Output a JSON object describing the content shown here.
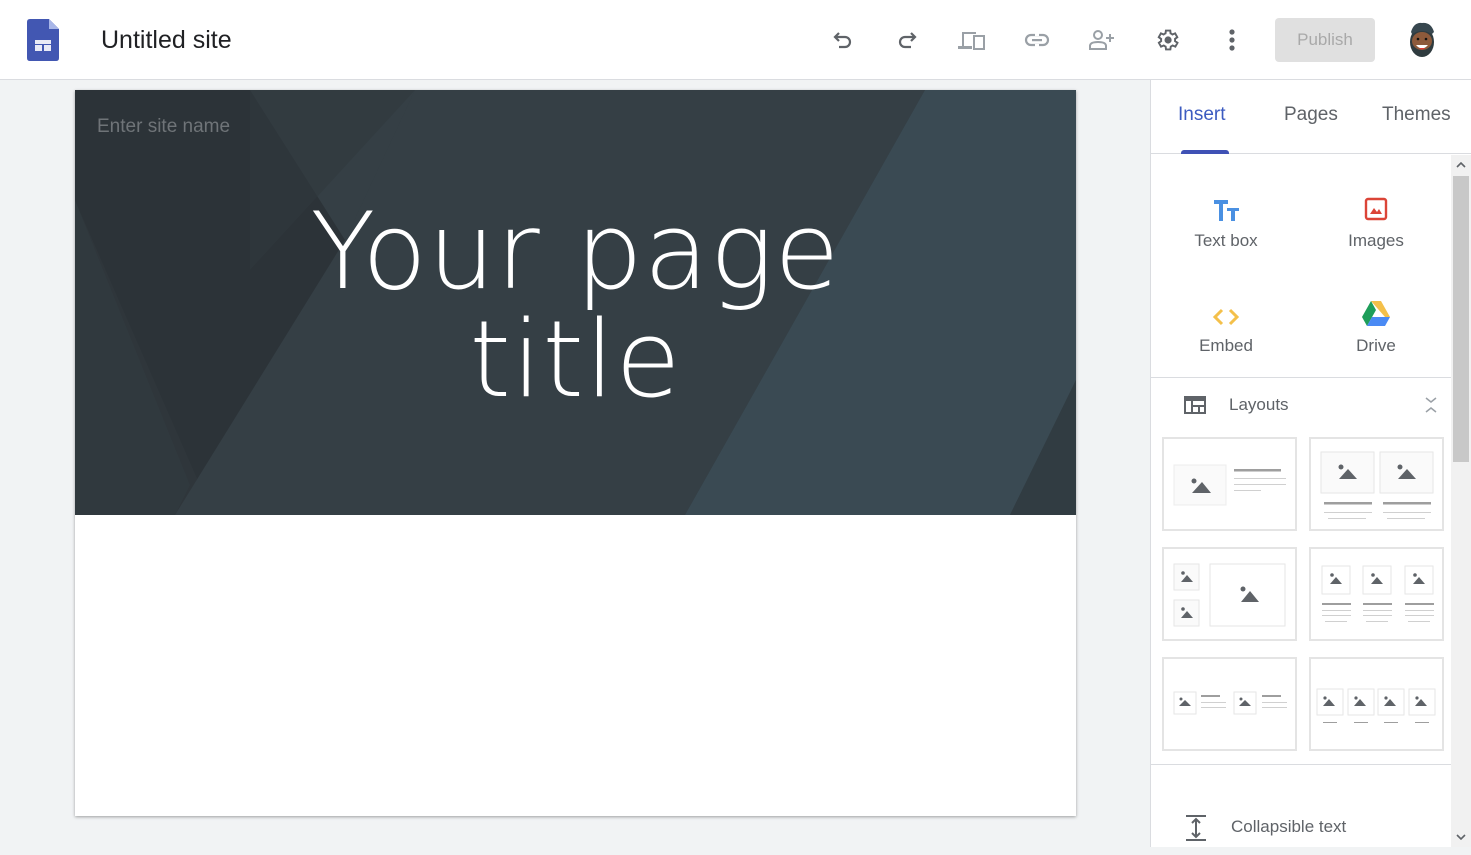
{
  "app": {
    "title": "Untitled site",
    "logo": "google-sites-logo"
  },
  "toolbar": {
    "icons": [
      "undo-icon",
      "redo-icon",
      "preview-devices-icon",
      "link-icon",
      "add-person-icon",
      "settings-gear-icon",
      "more-vert-icon"
    ],
    "publish_label": "Publish",
    "avatar": "user-avatar"
  },
  "canvas": {
    "site_name_placeholder": "Enter site name",
    "page_title_line1": "Your page",
    "page_title_line2": "title",
    "colors": {
      "hero_bg": "#353f45",
      "hero_dark": "#2c3338",
      "hero_light": "#3a4a53"
    }
  },
  "sidebar": {
    "tabs": [
      {
        "label": "Insert",
        "active": true
      },
      {
        "label": "Pages",
        "active": false
      },
      {
        "label": "Themes",
        "active": false
      }
    ],
    "insert_items": [
      {
        "label": "Text box",
        "icon": "text-box-icon",
        "color": "#4a90e2"
      },
      {
        "label": "Images",
        "icon": "image-icon",
        "color": "#db4437"
      },
      {
        "label": "Embed",
        "icon": "embed-code-icon",
        "color": "#f4b400"
      },
      {
        "label": "Drive",
        "icon": "google-drive-icon",
        "color": "#0f9d58"
      }
    ],
    "layouts": {
      "label": "Layouts",
      "thumbnails": [
        "image-left-text-right",
        "two-images-with-text",
        "two-small-one-large-image",
        "three-images-with-text",
        "two-image-text-pairs",
        "four-images-with-captions"
      ]
    },
    "collapsible_label": "Collapsible text"
  },
  "accent_color": "#3f51b5"
}
